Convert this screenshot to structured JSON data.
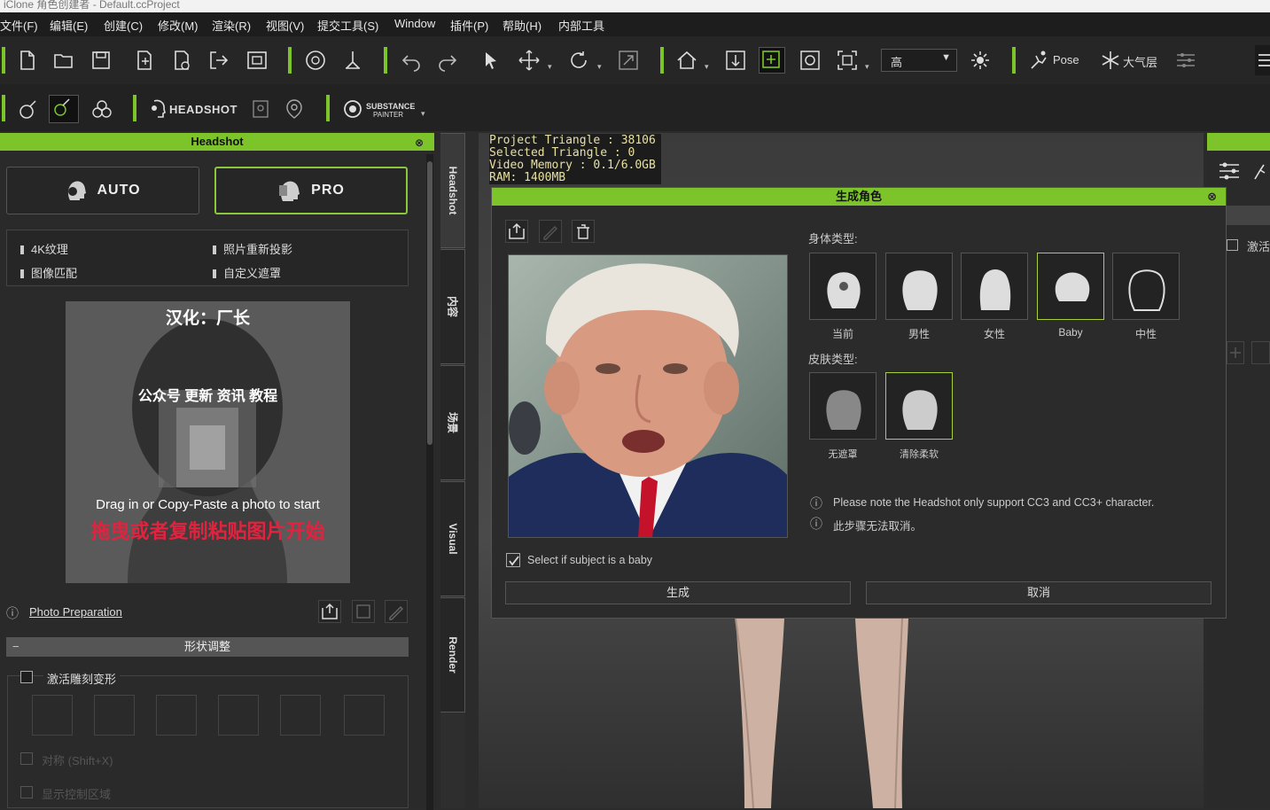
{
  "window": {
    "title": "iClone 角色创建者 - Default.ccProject"
  },
  "menu": [
    "文件(F)",
    "编辑(E)",
    "创建(C)",
    "修改(M)",
    "渲染(R)",
    "视图(V)",
    "提交工具(S)",
    "Window",
    "插件(P)",
    "帮助(H)",
    "内部工具"
  ],
  "toolbar1": {
    "quality_value": "高",
    "pose_label": "Pose",
    "atmosphere_label": "大气层",
    "colors": {
      "accent": "#7dc42a"
    }
  },
  "toolbar2": {
    "headshot_label": "HEADSHOT",
    "substance_label_top": "SUBSTANCE",
    "substance_label_bottom": "PAINTER"
  },
  "left_panel": {
    "header": "Headshot",
    "auto_label": "AUTO",
    "pro_label": "PRO",
    "features": [
      "4K纹理",
      "照片重新投影",
      "图像匹配",
      "自定义遮罩"
    ],
    "photo_overlay": {
      "line1": "汉化：厂长",
      "line2": "公众号 更新 资讯 教程",
      "drag_text_en": "Drag in or Copy-Paste a photo to start",
      "drag_text_cn": "拖曳或者复制粘贴图片开始"
    },
    "photo_prep_link": "Photo Preparation",
    "shape_section": "形状调整",
    "activate_morph": "激活雕刻变形",
    "option1": "对称 (Shift+X)",
    "option2": "显示控制区域"
  },
  "vtabs": [
    "Headshot",
    "内容",
    "场景",
    "Visual",
    "Render"
  ],
  "viewport": {
    "stats": [
      "Project Triangle : 38106",
      "Selected Triangle : 0",
      "Video Memory : 0.1/6.0GB",
      "RAM: 1400MB"
    ]
  },
  "dialog": {
    "title": "生成角色",
    "body_type_label": "身体类型:",
    "body_types": [
      {
        "label": "当前",
        "selected": false
      },
      {
        "label": "男性",
        "selected": false
      },
      {
        "label": "女性",
        "selected": false
      },
      {
        "label": "Baby",
        "selected": true
      },
      {
        "label": "中性",
        "selected": false
      }
    ],
    "skin_type_label": "皮肤类型:",
    "skin_types": [
      {
        "label": "无遮罩",
        "selected": false
      },
      {
        "label": "清除柔软",
        "selected": true
      }
    ],
    "note1": "Please note the Headshot only support CC3 and CC3+ character.",
    "note2": "此步骤无法取消。",
    "baby_checkbox": "Select if subject is a baby",
    "baby_checked": true,
    "generate_btn": "生成",
    "cancel_btn": "取消"
  },
  "right_panel": {
    "activate_label": "激活"
  }
}
